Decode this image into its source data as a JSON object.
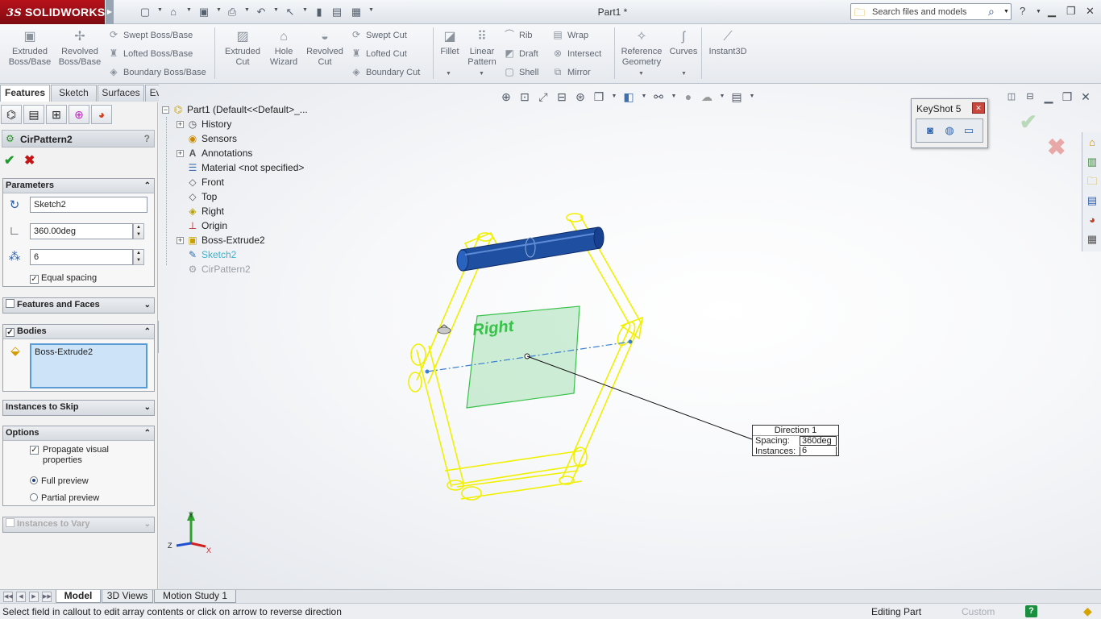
{
  "app": {
    "brand": "SOLIDWORKS",
    "brand_prefix": "3S",
    "document_title": "Part1 *"
  },
  "search": {
    "placeholder": "Search files and models"
  },
  "commands": {
    "extruded_boss": "Extruded Boss/Base",
    "revolved_boss": "Revolved Boss/Base",
    "swept_boss": "Swept Boss/Base",
    "lofted_boss": "Lofted Boss/Base",
    "boundary_boss": "Boundary Boss/Base",
    "extruded_cut": "Extruded Cut",
    "hole_wizard": "Hole Wizard",
    "revolved_cut": "Revolved Cut",
    "swept_cut": "Swept Cut",
    "lofted_cut": "Lofted Cut",
    "boundary_cut": "Boundary Cut",
    "fillet": "Fillet",
    "linear_pattern": "Linear Pattern",
    "rib": "Rib",
    "draft": "Draft",
    "shell": "Shell",
    "wrap": "Wrap",
    "intersect": "Intersect",
    "mirror": "Mirror",
    "reference_geometry": "Reference Geometry",
    "curves": "Curves",
    "instant3d": "Instant3D"
  },
  "tabs": [
    "Features",
    "Sketch",
    "Surfaces",
    "Evaluate"
  ],
  "property_manager": {
    "title": "CirPattern2",
    "help": "?",
    "parameters": {
      "header": "Parameters",
      "axis": "Sketch2",
      "angle": "360.00deg",
      "instances": "6",
      "equal_spacing": "Equal spacing"
    },
    "features_and_faces": "Features and Faces",
    "bodies": {
      "header": "Bodies",
      "item": "Boss-Extrude2"
    },
    "instances_to_skip": "Instances to Skip",
    "options": {
      "header": "Options",
      "propagate": "Propagate visual properties",
      "full_preview": "Full preview",
      "partial_preview": "Partial preview"
    },
    "instances_to_vary": "Instances to Vary"
  },
  "tree": {
    "root": "Part1  (Default<<Default>_...",
    "items": [
      "History",
      "Sensors",
      "Annotations",
      "Material <not specified>",
      "Front",
      "Top",
      "Right",
      "Origin",
      "Boss-Extrude2",
      "Sketch2",
      "CirPattern2"
    ]
  },
  "keyshot": {
    "title": "KeyShot 5"
  },
  "viewport": {
    "plane_label": "Right",
    "triad_y": "Y",
    "triad_x": "X",
    "triad_z": "Z"
  },
  "callout": {
    "title": "Direction 1",
    "spacing_label": "Spacing:",
    "spacing_value": "360deg",
    "instances_label": "Instances:",
    "instances_value": "6"
  },
  "bottom_tabs": [
    "Model",
    "3D Views",
    "Motion Study 1"
  ],
  "status": {
    "message": "Select field in callout to edit array contents or click on arrow to reverse direction",
    "mode": "Editing Part",
    "units": "Custom",
    "help": "?"
  },
  "colors": {
    "brand": "#a8121b",
    "accent_blue": "#1f4fa0",
    "preview_yellow": "#f0f000",
    "plane_green": "#39c24a"
  }
}
